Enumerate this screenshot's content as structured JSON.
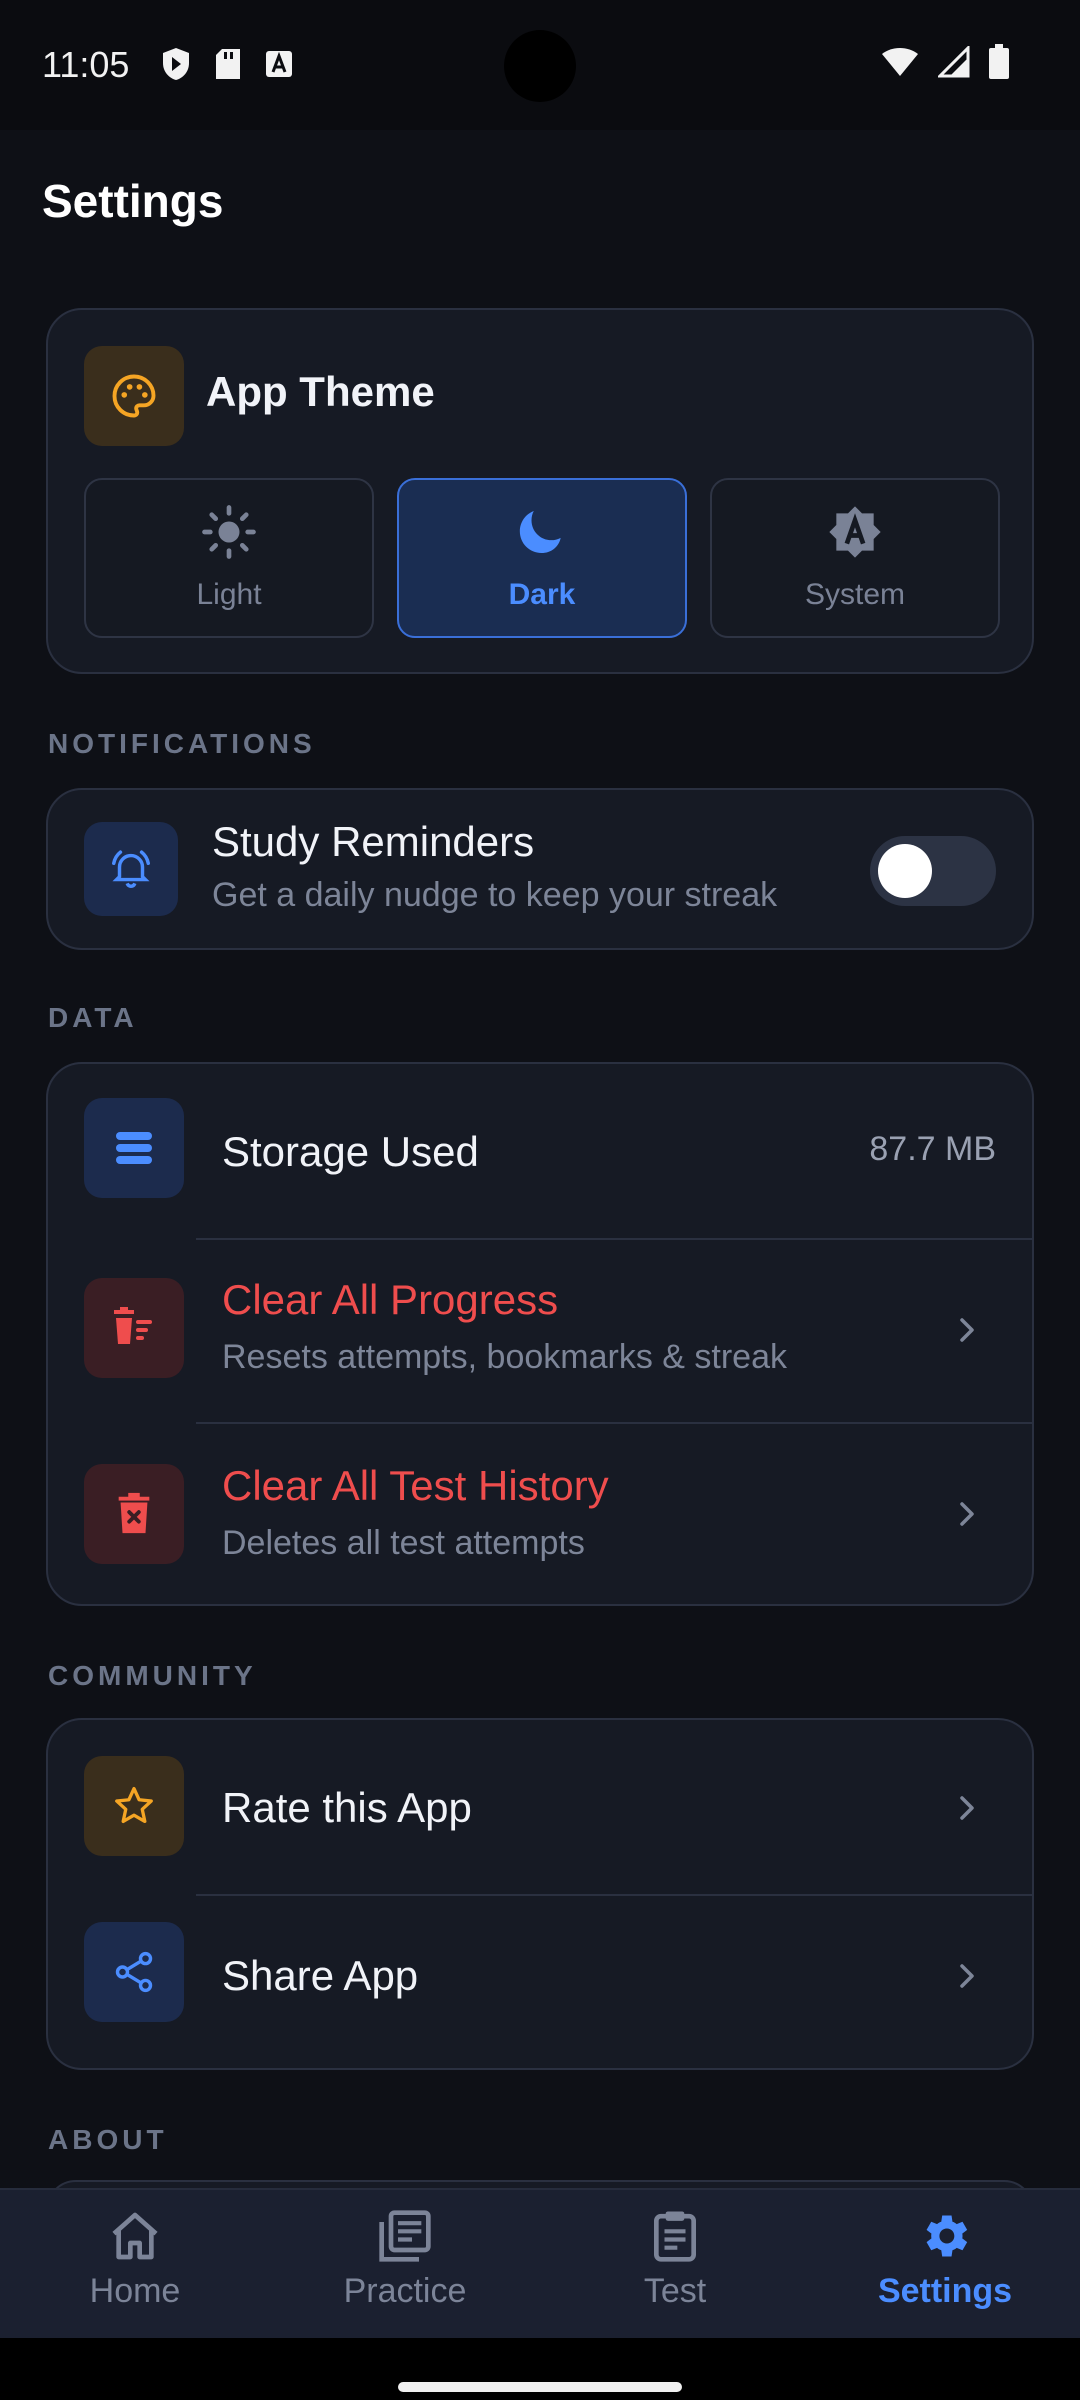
{
  "status_bar": {
    "time": "11:05"
  },
  "page": {
    "title": "Settings"
  },
  "theme": {
    "title": "App Theme",
    "options": [
      {
        "label": "Light",
        "icon": "sun-icon"
      },
      {
        "label": "Dark",
        "icon": "moon-icon",
        "selected": true
      },
      {
        "label": "System",
        "icon": "auto-theme-icon"
      }
    ]
  },
  "sections": {
    "notifications": "NOTIFICATIONS",
    "data": "DATA",
    "community": "COMMUNITY",
    "about": "ABOUT"
  },
  "notifications": {
    "reminders_title": "Study Reminders",
    "reminders_sub": "Get a daily nudge to keep your streak",
    "reminders_enabled": false
  },
  "data": {
    "storage_label": "Storage Used",
    "storage_value": "87.7 MB",
    "clear_progress_title": "Clear All Progress",
    "clear_progress_sub": "Resets attempts, bookmarks & streak",
    "clear_history_title": "Clear All Test History",
    "clear_history_sub": "Deletes all test attempts"
  },
  "community": {
    "rate_label": "Rate this App",
    "share_label": "Share App"
  },
  "bottom_nav": [
    {
      "label": "Home",
      "icon": "home-icon"
    },
    {
      "label": "Practice",
      "icon": "practice-icon"
    },
    {
      "label": "Test",
      "icon": "clipboard-icon"
    },
    {
      "label": "Settings",
      "icon": "gear-icon",
      "active": true
    }
  ],
  "colors": {
    "background": "#0e1016",
    "card": "#161a24",
    "accent": "#4b8dff",
    "danger": "#ef4d4d",
    "theme_icon": "#f5a524"
  }
}
